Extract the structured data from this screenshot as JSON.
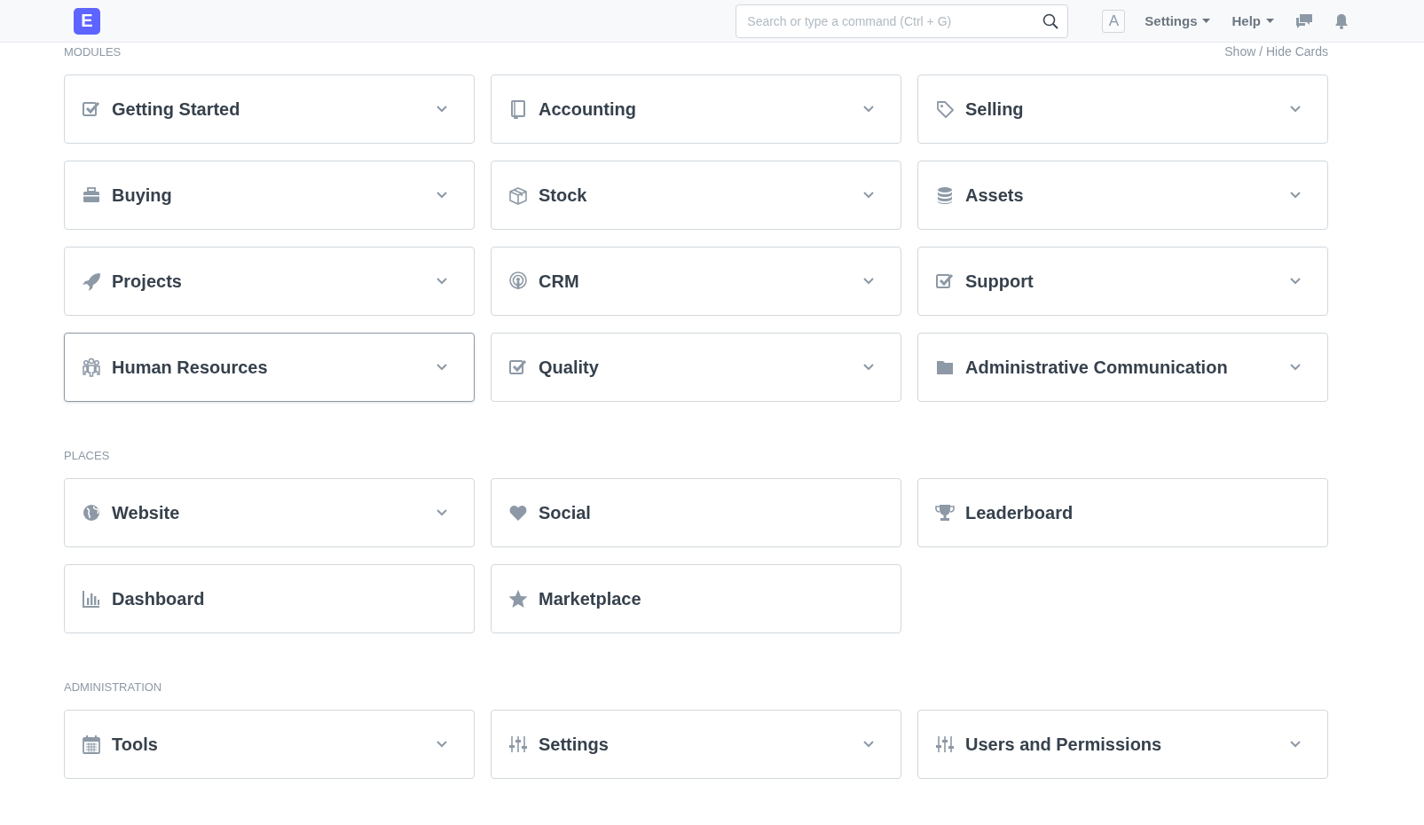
{
  "navbar": {
    "logo": "E",
    "search": {
      "placeholder": "Search or type a command (Ctrl + G)"
    },
    "avatar": "A",
    "menus": [
      {
        "label": "Settings"
      },
      {
        "label": "Help"
      }
    ]
  },
  "show_hide_cards": "Show / Hide Cards",
  "sections": [
    {
      "title": "MODULES",
      "cards": [
        {
          "label": "Getting Started",
          "expandable": true,
          "hovered": false
        },
        {
          "label": "Accounting",
          "expandable": true,
          "hovered": false
        },
        {
          "label": "Selling",
          "expandable": true,
          "hovered": false
        },
        {
          "label": "Buying",
          "expandable": true,
          "hovered": false
        },
        {
          "label": "Stock",
          "expandable": true,
          "hovered": false
        },
        {
          "label": "Assets",
          "expandable": true,
          "hovered": false
        },
        {
          "label": "Projects",
          "expandable": true,
          "hovered": false
        },
        {
          "label": "CRM",
          "expandable": true,
          "hovered": false
        },
        {
          "label": "Support",
          "expandable": true,
          "hovered": false
        },
        {
          "label": "Human Resources",
          "expandable": true,
          "hovered": true
        },
        {
          "label": "Quality",
          "expandable": true,
          "hovered": false
        },
        {
          "label": "Administrative Communication",
          "expandable": true,
          "hovered": false
        }
      ]
    },
    {
      "title": "PLACES",
      "cards": [
        {
          "label": "Website",
          "expandable": true,
          "hovered": false
        },
        {
          "label": "Social",
          "expandable": false,
          "hovered": false
        },
        {
          "label": "Leaderboard",
          "expandable": false,
          "hovered": false
        },
        {
          "label": "Dashboard",
          "expandable": false,
          "hovered": false
        },
        {
          "label": "Marketplace",
          "expandable": false,
          "hovered": false
        }
      ]
    },
    {
      "title": "ADMINISTRATION",
      "cards": [
        {
          "label": "Tools",
          "expandable": true,
          "hovered": false
        },
        {
          "label": "Settings",
          "expandable": true,
          "hovered": false
        },
        {
          "label": "Users and Permissions",
          "expandable": true,
          "hovered": false
        }
      ]
    }
  ]
}
